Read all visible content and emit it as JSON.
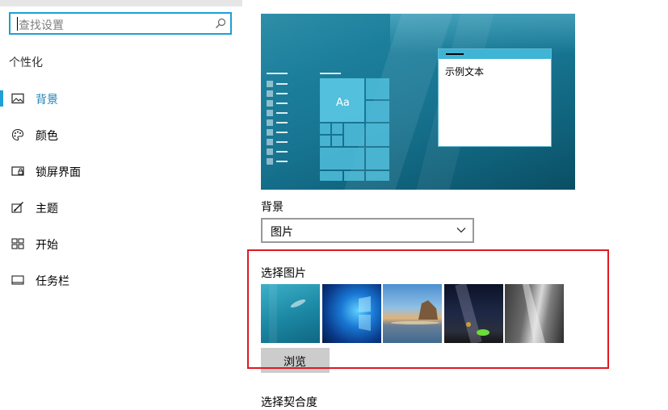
{
  "search": {
    "placeholder": "查找设置"
  },
  "sidebar": {
    "section_title": "个性化",
    "items": [
      {
        "label": "背景",
        "icon": "picture-icon",
        "active": true
      },
      {
        "label": "颜色",
        "icon": "palette-icon",
        "active": false
      },
      {
        "label": "锁屏界面",
        "icon": "lock-screen-icon",
        "active": false
      },
      {
        "label": "主题",
        "icon": "theme-brush-icon",
        "active": false
      },
      {
        "label": "开始",
        "icon": "start-grid-icon",
        "active": false
      },
      {
        "label": "任务栏",
        "icon": "taskbar-icon",
        "active": false
      }
    ]
  },
  "preview": {
    "sample_text": "示例文本",
    "tile_text": "Aa"
  },
  "background": {
    "label": "背景",
    "selected": "图片"
  },
  "pictures": {
    "label": "选择图片",
    "items": [
      "underwater-swimmer",
      "windows-blue-logo",
      "beach-rock-arch",
      "night-sky-tent",
      "rock-cliff"
    ],
    "browse_label": "浏览"
  },
  "fit": {
    "label": "选择契合度"
  },
  "colors": {
    "accent": "#1e9fd6",
    "highlight_box": "#e0191f"
  }
}
